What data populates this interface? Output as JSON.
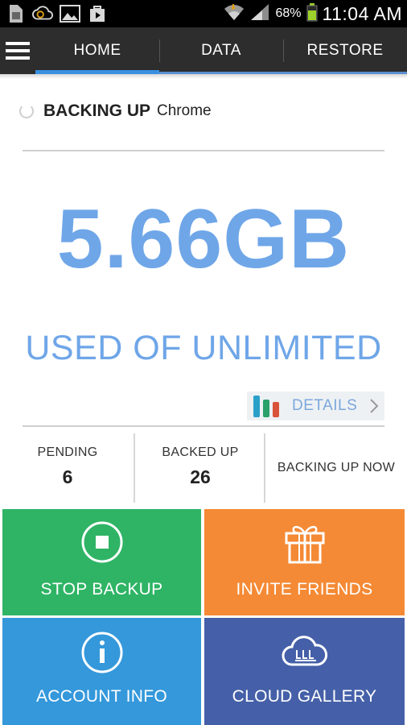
{
  "status_bar": {
    "battery_percent": "68%",
    "time": "11:04 AM",
    "icons": [
      "sim-card-icon",
      "cloud-sync-icon",
      "image-icon",
      "play-store-icon",
      "wifi-icon",
      "signal-icon",
      "battery-icon"
    ]
  },
  "tabs": [
    {
      "label": "HOME",
      "active": true
    },
    {
      "label": "DATA",
      "active": false
    },
    {
      "label": "RESTORE",
      "active": false
    }
  ],
  "backup_status": {
    "state": "BACKING UP",
    "app": "Chrome"
  },
  "usage": {
    "used": "5.66GB",
    "of_text": "USED OF UNLIMITED"
  },
  "details_button": {
    "label": "DETAILS"
  },
  "stats": {
    "pending": {
      "label": "PENDING",
      "value": "6"
    },
    "backed_up": {
      "label": "BACKED UP",
      "value": "26"
    },
    "now": {
      "label": "BACKING UP NOW"
    }
  },
  "tiles": {
    "stop_backup": {
      "label": "STOP BACKUP",
      "color": "#2fb465"
    },
    "invite_friends": {
      "label": "INVITE FRIENDS",
      "color": "#f48a35"
    },
    "account_info": {
      "label": "ACCOUNT INFO",
      "color": "#3498db"
    },
    "cloud_gallery": {
      "label": "CLOUD GALLERY",
      "color": "#4560a8"
    }
  },
  "colors": {
    "accent_blue": "#6fa6e8",
    "tab_indicator": "#3a8fe0",
    "action_bar": "#2d2d2d"
  }
}
